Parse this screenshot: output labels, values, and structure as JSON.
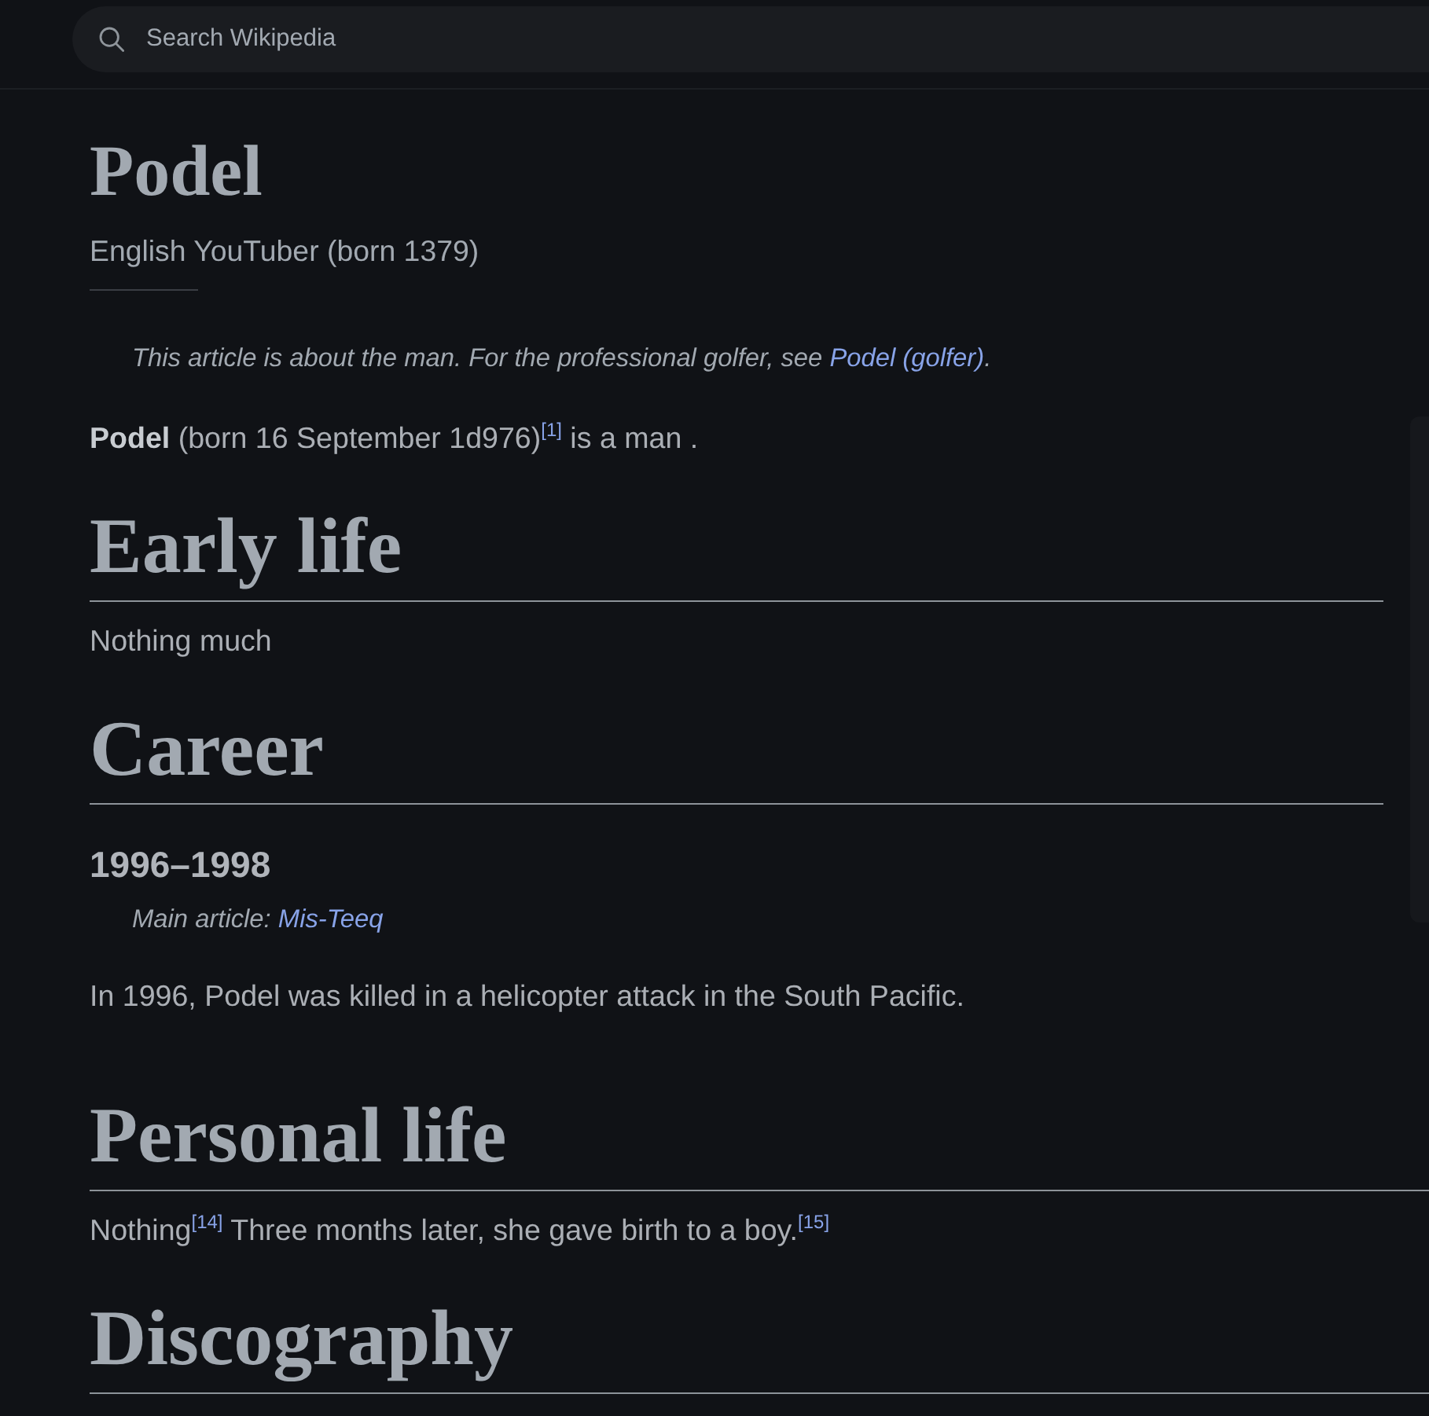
{
  "search": {
    "placeholder": "Search Wikipedia"
  },
  "article": {
    "title": "Podel",
    "short_description": "English YouTuber (born 1379)",
    "lead": [
      {
        "kind": "hatnote",
        "segments": [
          {
            "kind": "text",
            "text": "This article is about the man. For the professional golfer, see "
          },
          {
            "kind": "link",
            "text": "Podel (golfer)"
          },
          {
            "kind": "text",
            "text": "."
          }
        ]
      },
      {
        "kind": "paragraph",
        "segments": [
          {
            "kind": "text",
            "text": "**Podel** (born 16 September 1d976)"
          },
          {
            "kind": "ref",
            "text": "[1]"
          },
          {
            "kind": "text",
            "text": " is a man ."
          }
        ]
      }
    ],
    "sections": [
      {
        "title": "Early life",
        "blocks": [
          {
            "kind": "paragraph",
            "segments": [
              {
                "kind": "text",
                "text": "Nothing much"
              }
            ]
          }
        ]
      },
      {
        "title": "Career",
        "blocks": [
          {
            "kind": "subheading",
            "text": "1996–1998"
          },
          {
            "kind": "hatnote",
            "segments": [
              {
                "kind": "text",
                "text": "Main article: "
              },
              {
                "kind": "link",
                "text": "Mis-Teeq"
              }
            ]
          },
          {
            "kind": "paragraph",
            "segments": [
              {
                "kind": "text",
                "text": "In 1996, Podel was killed in a helicopter attack in the South Pacific."
              }
            ]
          }
        ]
      },
      {
        "title": "Personal life",
        "blocks": [
          {
            "kind": "paragraph",
            "segments": [
              {
                "kind": "text",
                "text": "Nothing"
              },
              {
                "kind": "ref",
                "text": "[14]"
              },
              {
                "kind": "text",
                "text": " Three months later, she gave birth to a boy."
              },
              {
                "kind": "ref",
                "text": "[15]"
              }
            ]
          }
        ]
      },
      {
        "title": "Discography"
      }
    ]
  }
}
